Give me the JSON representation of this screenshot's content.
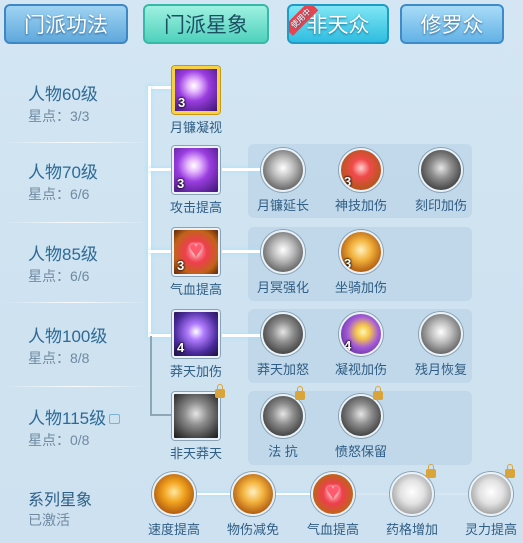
{
  "tabs": [
    {
      "label": "门派功法"
    },
    {
      "label": "门派星象"
    },
    {
      "label": "非天众",
      "ribbon": "使用中"
    },
    {
      "label": "修罗众"
    }
  ],
  "levels": [
    {
      "title": "人物60级",
      "stars": "星点：3/3"
    },
    {
      "title": "人物70级",
      "stars": "星点：6/6"
    },
    {
      "title": "人物85级",
      "stars": "星点：6/6"
    },
    {
      "title": "人物100级",
      "stars": "星点：8/8"
    },
    {
      "title": "人物115级",
      "stars": "星点：0/8",
      "locked": true
    }
  ],
  "rows": [
    {
      "skills": [
        {
          "label": "月镰凝视",
          "level": "3",
          "icon": "purple-claw-icon",
          "selected": true
        }
      ]
    },
    {
      "skills": [
        {
          "label": "攻击提高",
          "level": "3",
          "icon": "purple-claw-icon"
        },
        {
          "label": "月镰延长",
          "level": "",
          "icon": "grey-claw-icon"
        },
        {
          "label": "神技加伤",
          "level": "3",
          "icon": "red-demon-icon"
        },
        {
          "label": "刻印加伤",
          "level": "",
          "icon": "grey-mark-icon"
        }
      ]
    },
    {
      "skills": [
        {
          "label": "气血提高",
          "level": "3",
          "icon": "heart-icon"
        },
        {
          "label": "月冥强化",
          "level": "",
          "icon": "grey-orb-icon"
        },
        {
          "label": "坐骑加伤",
          "level": "3",
          "icon": "golden-beast-icon"
        }
      ]
    },
    {
      "skills": [
        {
          "label": "莽天加伤",
          "level": "4",
          "icon": "violet-burst-icon"
        },
        {
          "label": "莽天加怒",
          "level": "",
          "icon": "grey-burst-icon"
        },
        {
          "label": "凝视加伤",
          "level": "4",
          "icon": "crescent-moon-icon"
        },
        {
          "label": "残月恢复",
          "level": "",
          "icon": "grey-ring-icon"
        }
      ]
    },
    {
      "skills": [
        {
          "label": "非天莽天",
          "level": "",
          "icon": "winged-deity-icon",
          "locked": true
        },
        {
          "label": "法 抗",
          "level": "",
          "icon": "winged-deity-icon",
          "locked": true
        },
        {
          "label": "愤怒保留",
          "level": "",
          "icon": "winged-deity-icon",
          "locked": true
        }
      ]
    }
  ],
  "series": {
    "title": "系列星象",
    "status": "已激活",
    "skills": [
      {
        "label": "速度提高",
        "icon": "flame-icon"
      },
      {
        "label": "物伤减免",
        "icon": "golden-figure-icon"
      },
      {
        "label": "气血提高",
        "icon": "heart-icon"
      },
      {
        "label": "药格增加",
        "icon": "silver-flask-icon",
        "locked": true
      },
      {
        "label": "灵力提高",
        "icon": "silver-figure-icon",
        "locked": true
      }
    ]
  },
  "colors": {
    "accent_tab": "#4fd1bd",
    "glow": "#9fe3ff",
    "label": "#2f5d84"
  }
}
